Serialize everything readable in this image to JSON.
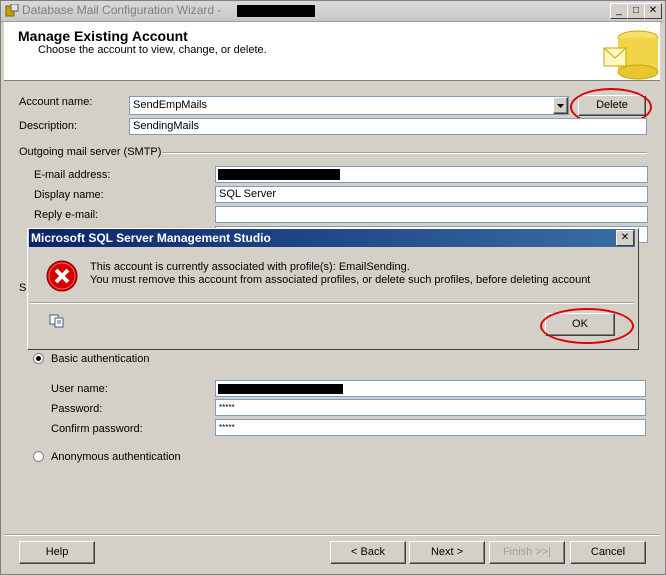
{
  "window": {
    "title": "Database Mail Configuration Wizard -",
    "minimize": "_",
    "maximize": "□",
    "close": "✕"
  },
  "header": {
    "title": "Manage Existing Account",
    "subtitle": "Choose the account to view, change, or delete."
  },
  "account": {
    "name_label": "Account name:",
    "name_value": "SendEmpMails",
    "delete_label": "Delete",
    "description_label": "Description:",
    "description_value": "SendingMails"
  },
  "smtp": {
    "group_label": "Outgoing mail server (SMTP)",
    "email_label": "E-mail address:",
    "display_label": "Display name:",
    "display_value": "SQL Server",
    "reply_label": "Reply e-mail:"
  },
  "auth": {
    "section_letter": "S",
    "basic_label": "Basic authentication",
    "username_label": "User name:",
    "password_label": "Password:",
    "password_value": "*****",
    "confirm_label": "Confirm password:",
    "confirm_value": "*****",
    "anonymous_label": "Anonymous authentication"
  },
  "dialog": {
    "title": "Microsoft SQL Server Management Studio",
    "close": "✕",
    "line1": "This account is currently associated with profile(s): EmailSending.",
    "line2": "You must remove this account from associated profiles, or delete such profiles, before deleting account",
    "ok_label": "OK",
    "error_icon": "error-x-icon",
    "copy_icon": "copy-icon"
  },
  "footer": {
    "help": "Help",
    "back": "< Back",
    "next": "Next >",
    "finish": "Finish >>|",
    "cancel": "Cancel"
  },
  "colors": {
    "highlight_ring": "#dd0000",
    "dialog_title": "#0a246a",
    "error_red": "#d40000"
  }
}
